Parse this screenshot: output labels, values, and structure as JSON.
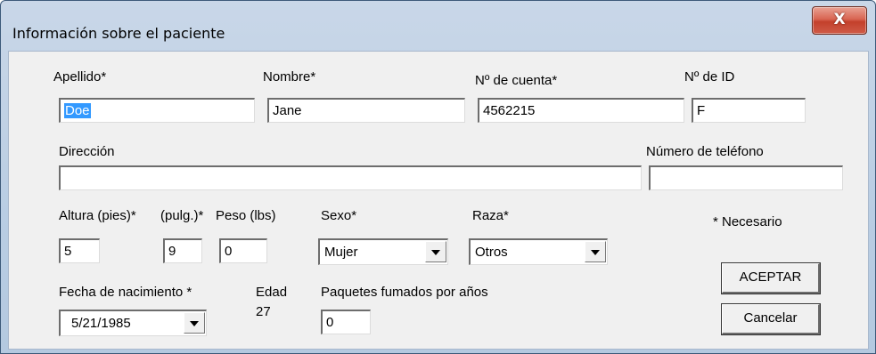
{
  "window": {
    "title": "Información sobre el paciente",
    "close_label": "X"
  },
  "labels": {
    "apellido": "Apellido*",
    "nombre": "Nombre*",
    "cuenta": "Nº de cuenta*",
    "id": "Nº de ID",
    "direccion": "Dirección",
    "telefono": "Número de teléfono",
    "altura_pies": "Altura (pies)*",
    "altura_pulg": "(pulg.)*",
    "peso": "Peso (lbs)",
    "sexo": "Sexo*",
    "raza": "Raza*",
    "necesario": "* Necesario",
    "fecha": "Fecha de nacimiento *",
    "edad": "Edad",
    "paquetes": "Paquetes fumados por años"
  },
  "values": {
    "apellido": "Doe",
    "nombre": "Jane",
    "cuenta": "4562215",
    "id": "F",
    "direccion": "",
    "telefono": "",
    "altura_pies": "5",
    "altura_pulg": "9",
    "peso": "0",
    "sexo": "Mujer",
    "raza": "Otros",
    "fecha": "5/21/1985",
    "edad": "27",
    "paquetes": "0"
  },
  "buttons": {
    "aceptar": "ACEPTAR",
    "cancelar": "Cancelar"
  }
}
